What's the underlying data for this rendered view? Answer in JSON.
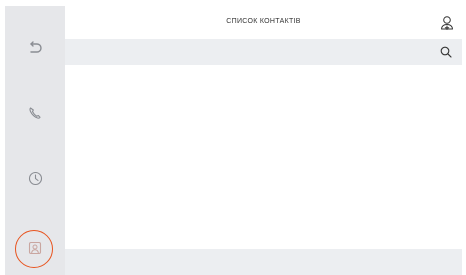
{
  "header": {
    "title": "СПИСОК КОНТАКТІВ"
  },
  "search": {
    "placeholder": "",
    "value": ""
  },
  "contacts": [],
  "sidebar": {
    "items": [
      {
        "id": "back",
        "icon": "back-arrow-icon",
        "active": false
      },
      {
        "id": "calls",
        "icon": "phone-icon",
        "active": false
      },
      {
        "id": "history",
        "icon": "clock-icon",
        "active": false
      },
      {
        "id": "contacts",
        "icon": "contact-card-icon",
        "active": true
      }
    ],
    "active_color": "#e8541f",
    "icon_color": "#8a8d93",
    "background": "#e6e7ea"
  },
  "colors": {
    "search_bar": "#eceef1",
    "footer_bar": "#eceef1",
    "content": "#ffffff"
  }
}
